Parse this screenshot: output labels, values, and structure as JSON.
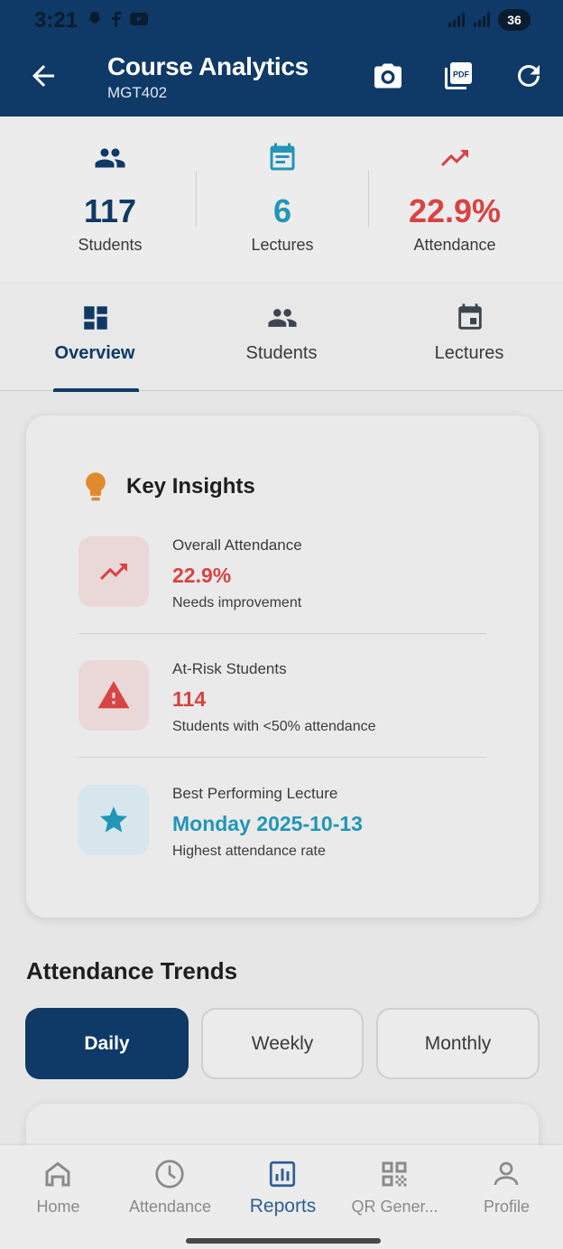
{
  "status_bar": {
    "time": "3:21",
    "battery": "36"
  },
  "header": {
    "title": "Course Analytics",
    "subtitle": "MGT402",
    "colors": {
      "bar": "#0f3966"
    }
  },
  "stats": [
    {
      "value": "117",
      "label": "Students",
      "icon": "people-icon",
      "color": "#0f3966"
    },
    {
      "value": "6",
      "label": "Lectures",
      "icon": "calendar-note-icon",
      "color": "#2196b7"
    },
    {
      "value": "22.9%",
      "label": "Attendance",
      "icon": "trending-up-icon",
      "color": "#d84343"
    }
  ],
  "tabs": [
    {
      "label": "Overview",
      "icon": "dashboard-icon",
      "active": true
    },
    {
      "label": "Students",
      "icon": "people-icon"
    },
    {
      "label": "Lectures",
      "icon": "calendar-icon"
    }
  ],
  "insights": {
    "title": "Key Insights",
    "items": [
      {
        "label": "Overall Attendance",
        "value": "22.9%",
        "note": "Needs improvement",
        "icon": "trending-up-icon",
        "color": "#d84343"
      },
      {
        "label": "At-Risk Students",
        "value": "114",
        "note": "Students with <50% attendance",
        "icon": "warning-icon",
        "color": "#d84343"
      },
      {
        "label": "Best Performing Lecture",
        "value": "Monday 2025-10-13",
        "note": "Highest attendance rate",
        "icon": "star-icon",
        "color": "#2196b7"
      }
    ]
  },
  "trends": {
    "title": "Attendance Trends",
    "options": [
      "Daily",
      "Weekly",
      "Monthly"
    ],
    "selected": "Daily"
  },
  "bottom_nav": [
    {
      "label": "Home",
      "icon": "home-icon"
    },
    {
      "label": "Attendance",
      "icon": "clock-icon"
    },
    {
      "label": "Reports",
      "icon": "reports-icon",
      "active": true
    },
    {
      "label": "QR Gener...",
      "icon": "qr-code-icon"
    },
    {
      "label": "Profile",
      "icon": "profile-icon"
    }
  ]
}
